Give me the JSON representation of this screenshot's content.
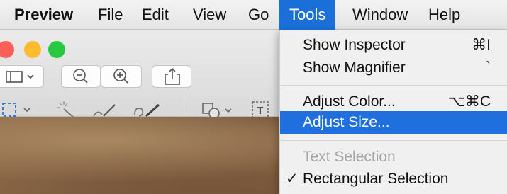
{
  "menubar": {
    "app": "Preview",
    "items": [
      "File",
      "Edit",
      "View",
      "Go",
      "Tools",
      "Window",
      "Help"
    ]
  },
  "tools_menu": {
    "items": [
      {
        "label": "Show Inspector",
        "shortcut": "⌘I"
      },
      {
        "label": "Show Magnifier",
        "shortcut": "`"
      },
      {
        "label": "Adjust Color...",
        "shortcut": "⌥⌘C"
      },
      {
        "label": "Adjust Size..."
      },
      {
        "label": "Text Selection"
      },
      {
        "label": "Rectangular Selection",
        "check": "✓"
      }
    ]
  },
  "toolbar": {
    "icons": [
      "sidebar-icon",
      "zoom-out-icon",
      "zoom-in-icon",
      "share-icon",
      "rect-select-icon",
      "instant-alpha-icon",
      "sketch-icon",
      "draw-icon",
      "shapes-icon",
      "text-icon"
    ],
    "text_tool_label": "T"
  },
  "colors": {
    "highlight": "#1f6fde",
    "traffic_red": "#fc5f57",
    "traffic_yellow": "#fdbc2e",
    "traffic_green": "#28c840"
  }
}
